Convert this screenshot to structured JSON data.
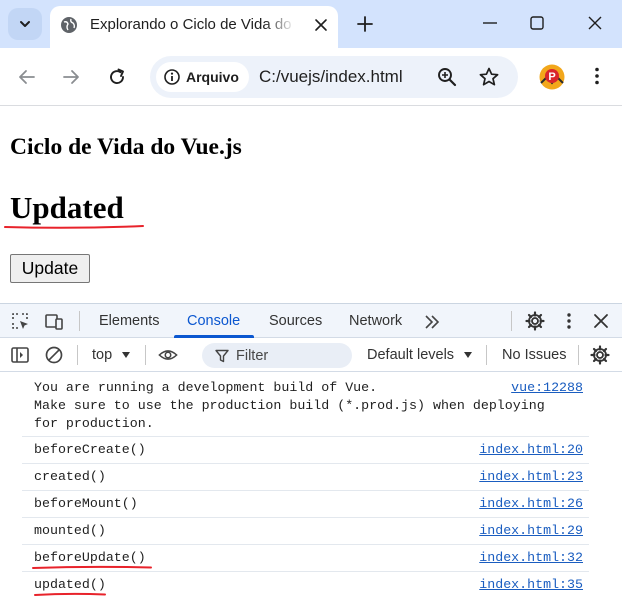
{
  "browser": {
    "tab_title": "Explorando o Ciclo de Vida do Vue.js",
    "site_info_label": "Arquivo",
    "url": "C:/vuejs/index.html",
    "profile_letter": "P"
  },
  "page": {
    "heading": "Ciclo de Vida do Vue.js",
    "message": "Updated",
    "button_label": "Update"
  },
  "devtools": {
    "tabs": [
      "Elements",
      "Console",
      "Sources",
      "Network"
    ],
    "active_tab": "Console",
    "context": "top",
    "filter_placeholder": "Filter",
    "levels": "Default levels",
    "issues": "No Issues",
    "messages": [
      {
        "text": "You are running a development build of Vue.\nMake sure to use the production build (*.prod.js) when deploying\nfor production.",
        "source": "vue:12288"
      },
      {
        "text": "beforeCreate()",
        "source": "index.html:20"
      },
      {
        "text": "created()",
        "source": "index.html:23"
      },
      {
        "text": "beforeMount()",
        "source": "index.html:26"
      },
      {
        "text": "mounted()",
        "source": "index.html:29"
      },
      {
        "text": "beforeUpdate()",
        "source": "index.html:32"
      },
      {
        "text": "updated()",
        "source": "index.html:35"
      }
    ]
  },
  "colors": {
    "tabstrip": "#d3e3fd",
    "accent": "#0b57d0",
    "annotation_red": "#e8232b",
    "link": "#1a5dc0"
  }
}
